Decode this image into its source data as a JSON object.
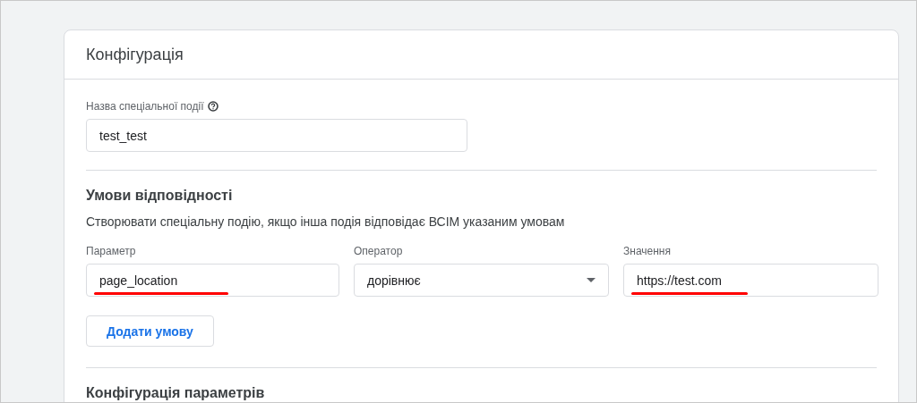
{
  "card": {
    "title": "Конфігурація"
  },
  "event_name": {
    "label": "Назва спеціальної події",
    "value": "test_test"
  },
  "conditions": {
    "title": "Умови відповідності",
    "description": "Створювати спеціальну подію, якщо інша подія відповідає ВСІМ указаним умовам",
    "fields": [
      {
        "kind": "text",
        "label": "Параметр",
        "value": "page_location",
        "highlighted": true
      },
      {
        "kind": "select",
        "label": "Оператор",
        "value": "дорівнює",
        "highlighted": false
      },
      {
        "kind": "text",
        "label": "Значення",
        "value": "https://test.com",
        "highlighted": true
      }
    ],
    "add_button": "Додати умову"
  },
  "parameters": {
    "title": "Конфігурація параметрів"
  }
}
